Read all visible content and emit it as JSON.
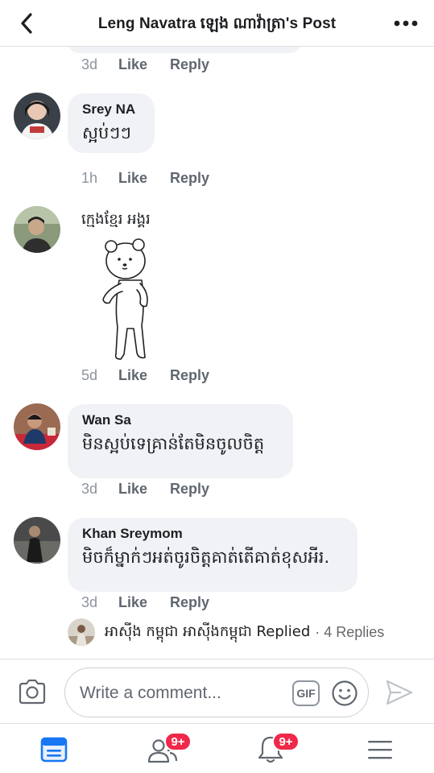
{
  "header": {
    "title": "Leng Navatra   ឡេង ណាវ៉ាត្រា's Post"
  },
  "actions": {
    "like": "Like",
    "reply": "Reply"
  },
  "comments": [
    {
      "time": "3d"
    },
    {
      "name": "Srey NA",
      "text": "ស្អប់ៗៗ",
      "time": "1h"
    },
    {
      "name": "ក្មេងខ្មែរ អង្គរ",
      "time": "5d"
    },
    {
      "name": "Wan Sa",
      "text": "មិនស្អប់ទេគ្រាន់តែមិនចូលចិត្ត",
      "time": "3d"
    },
    {
      "name": "Khan Sreymom",
      "text": "មិចក៏ម្នាក់ៗអត់ចូរចិត្តគាត់តើគាត់ខុសអីរ.",
      "time": "3d"
    }
  ],
  "replies": {
    "who": "អាស៊ីង កម្ពុជា អាស៊ីងកម្ពុជា Replied",
    "count": "· 4 Replies"
  },
  "composer": {
    "placeholder": "Write a comment...",
    "gif_label": "GIF"
  },
  "tabbar": {
    "friends_badge": "9+",
    "notifications_badge": "9+"
  },
  "colors": {
    "accent": "#1877f2",
    "badge": "#f02849",
    "bubble": "#f0f2f5"
  }
}
